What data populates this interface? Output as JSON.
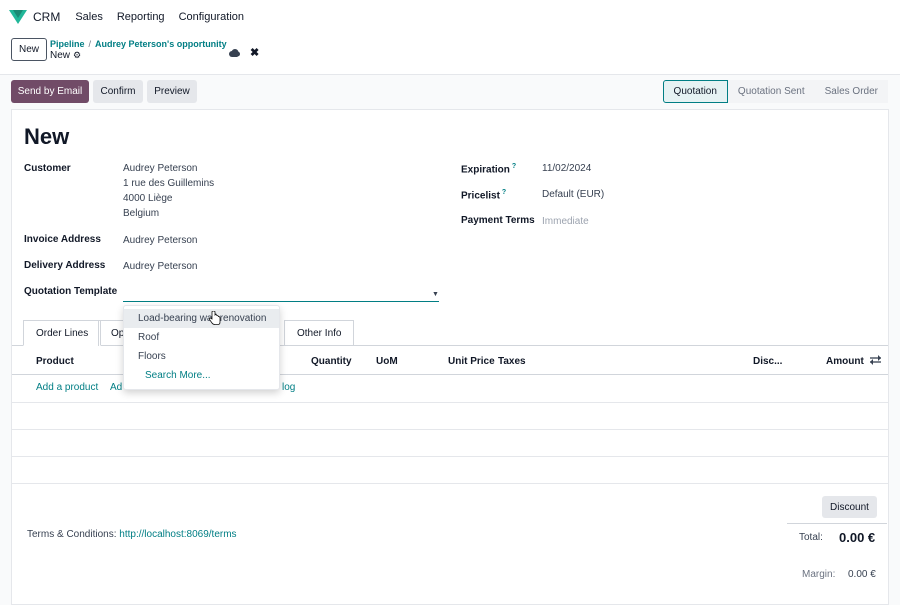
{
  "nav": {
    "app": "CRM",
    "menu": [
      "Sales",
      "Reporting",
      "Configuration"
    ]
  },
  "control": {
    "new_button": "New",
    "breadcrumb": [
      "Pipeline",
      "Audrey Peterson's opportunity"
    ],
    "record": "New"
  },
  "actions": {
    "send_email": "Send by Email",
    "confirm": "Confirm",
    "preview": "Preview"
  },
  "stages": [
    "Quotation",
    "Quotation Sent",
    "Sales Order"
  ],
  "form": {
    "title": "New",
    "customer_label": "Customer",
    "customer": [
      "Audrey Peterson",
      "1 rue des Guillemins",
      "4000 Liège",
      "Belgium"
    ],
    "invoice_label": "Invoice Address",
    "invoice": "Audrey Peterson",
    "delivery_label": "Delivery Address",
    "delivery": "Audrey Peterson",
    "template_label": "Quotation Template",
    "expiration_label": "Expiration",
    "expiration": "11/02/2024",
    "pricelist_label": "Pricelist",
    "pricelist": "Default (EUR)",
    "payment_label": "Payment Terms",
    "payment": "Immediate",
    "help_mark": "?"
  },
  "tabs": [
    "Order Lines",
    "Opt",
    "Other Info"
  ],
  "table": {
    "headers": [
      "Product",
      "Quantity",
      "UoM",
      "Unit Price",
      "Taxes",
      "Disc...",
      "Amount"
    ],
    "links": [
      "Add a product",
      "Ad",
      "log"
    ]
  },
  "dropdown": [
    "Load-bearing wall renovation",
    "Roof",
    "Floors",
    "Search More..."
  ],
  "footer": {
    "discount": "Discount",
    "terms_label": "Terms & Conditions:",
    "terms_link": "http://localhost:8069/terms",
    "total_label": "Total:",
    "total": "0.00 €",
    "margin_label": "Margin:",
    "margin": "0.00 €"
  },
  "colors": {
    "brand": "#714b67",
    "accent": "#017e84"
  }
}
